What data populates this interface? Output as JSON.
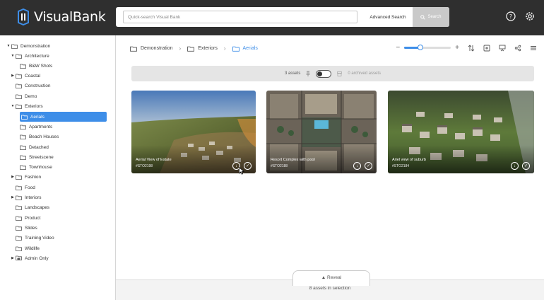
{
  "app": {
    "name": "VisualBank"
  },
  "search": {
    "placeholder": "Quick-search Visual Bank",
    "advanced_label": "Advanced Search",
    "button_label": "Search"
  },
  "sidebar": {
    "items": [
      {
        "label": "Demonstration",
        "level": 0,
        "caret": "▼"
      },
      {
        "label": "Architecture",
        "level": 1,
        "caret": "▼"
      },
      {
        "label": "B&W Shots",
        "level": 2,
        "caret": ""
      },
      {
        "label": "Coastal",
        "level": 1,
        "caret": "▶"
      },
      {
        "label": "Construction",
        "level": 1,
        "caret": ""
      },
      {
        "label": "Demo",
        "level": 1,
        "caret": ""
      },
      {
        "label": "Exteriors",
        "level": 1,
        "caret": "▼"
      },
      {
        "label": "Aerials",
        "level": 2,
        "caret": "",
        "selected": true
      },
      {
        "label": "Apartments",
        "level": 2,
        "caret": ""
      },
      {
        "label": "Beach Houses",
        "level": 2,
        "caret": ""
      },
      {
        "label": "Detached",
        "level": 2,
        "caret": ""
      },
      {
        "label": "Streetscene",
        "level": 2,
        "caret": ""
      },
      {
        "label": "Townhouse",
        "level": 2,
        "caret": ""
      },
      {
        "label": "Fashion",
        "level": 1,
        "caret": "▶"
      },
      {
        "label": "Food",
        "level": 1,
        "caret": ""
      },
      {
        "label": "Interiors",
        "level": 1,
        "caret": "▶"
      },
      {
        "label": "Landscapes",
        "level": 1,
        "caret": ""
      },
      {
        "label": "Product",
        "level": 1,
        "caret": ""
      },
      {
        "label": "Slides",
        "level": 1,
        "caret": ""
      },
      {
        "label": "Training Video",
        "level": 1,
        "caret": ""
      },
      {
        "label": "Wildlife",
        "level": 1,
        "caret": ""
      },
      {
        "label": "Admin Only",
        "level": 0,
        "caret": "▶",
        "locked": true
      }
    ]
  },
  "breadcrumb": [
    "Demonstration",
    "Exteriors",
    "Aerials"
  ],
  "assetbar": {
    "count": "3 assets",
    "archived": "0 archived assets"
  },
  "zoom": {
    "level_fraction": 0.35
  },
  "assets": [
    {
      "title": "Aerial View of Estate",
      "code": "#STO2198"
    },
    {
      "title": "Resort Complex with pool",
      "code": "#STO2188"
    },
    {
      "title": "Ariel view of suburb",
      "code": "#STO2184"
    }
  ],
  "footer": {
    "reveal": "Reveal",
    "selection": "8 assets in selection"
  },
  "colors": {
    "accent": "#3e8ee8",
    "topbar": "#2f2f2f"
  }
}
